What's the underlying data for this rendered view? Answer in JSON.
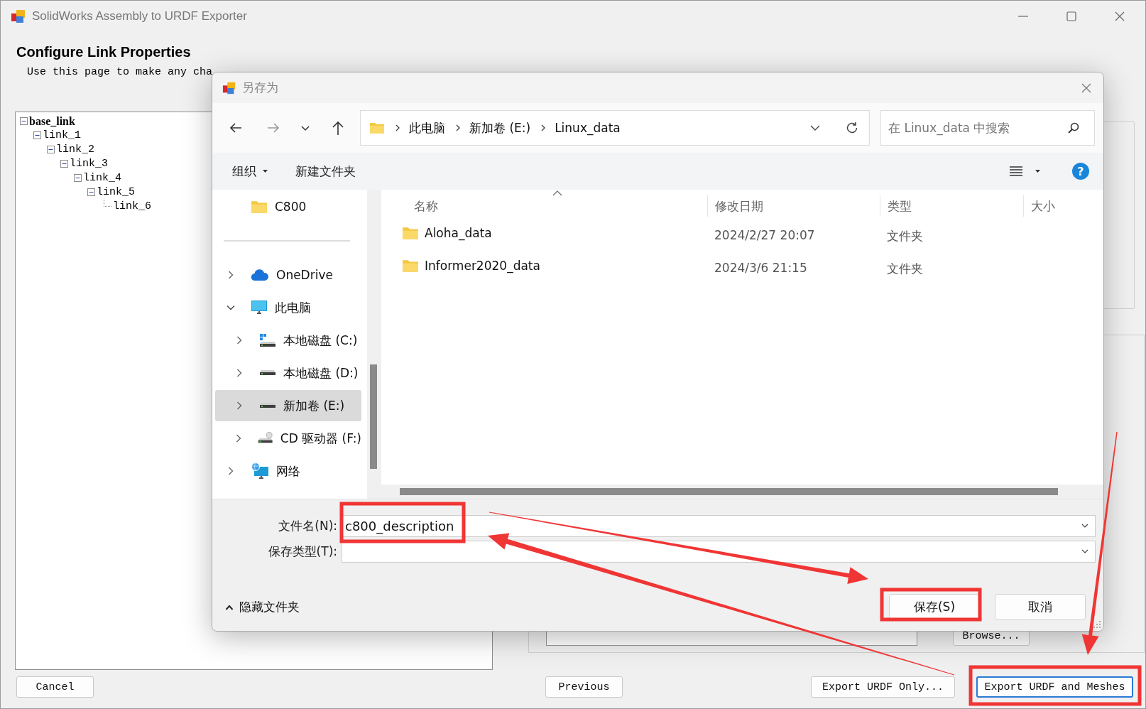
{
  "window": {
    "title": "SolidWorks Assembly to URDF Exporter"
  },
  "page": {
    "heading": "Configure Link Properties",
    "description": "Use this page to make any cha"
  },
  "link_tree": [
    {
      "label": "base_link",
      "expanded": true,
      "children": [
        {
          "label": "link_1",
          "expanded": true,
          "children": [
            {
              "label": "link_2",
              "expanded": true,
              "children": [
                {
                  "label": "link_3",
                  "expanded": true,
                  "children": [
                    {
                      "label": "link_4",
                      "expanded": true,
                      "children": [
                        {
                          "label": "link_5",
                          "expanded": true,
                          "children": [
                            {
                              "label": "link_6"
                            }
                          ]
                        }
                      ]
                    }
                  ]
                }
              ]
            }
          ]
        }
      ]
    }
  ],
  "right_panel": {
    "browse_button": "Browse..."
  },
  "buttons": [
    {
      "label": "Cancel",
      "focused": false
    },
    {
      "label": "Previous",
      "focused": false
    },
    {
      "label": "Export URDF Only...",
      "focused": false
    },
    {
      "label": "Export URDF and Meshes",
      "focused": true
    }
  ],
  "dialog": {
    "title": "另存为",
    "breadcrumb": [
      "此电脑",
      "新加卷 (E:)",
      "Linux_data"
    ],
    "search": {
      "placeholder": "在 Linux_data 中搜索"
    },
    "toolbar": {
      "organize": "组织",
      "new_folder": "新建文件夹",
      "help": "?"
    },
    "nav": [
      {
        "label": "C800",
        "kind": "folder",
        "selected": false
      },
      {
        "kind": "separator"
      },
      {
        "label": "OneDrive",
        "kind": "cloud",
        "expanded": false,
        "selected": false
      },
      {
        "label": "此电脑",
        "kind": "computer",
        "expanded": true,
        "selected": false,
        "children": [
          {
            "label": "本地磁盘 (C:)",
            "kind": "system-drive",
            "expanded": false,
            "selected": false
          },
          {
            "label": "本地磁盘 (D:)",
            "kind": "drive",
            "expanded": false,
            "selected": false
          },
          {
            "label": "新加卷 (E:)",
            "kind": "drive",
            "expanded": false,
            "selected": true
          },
          {
            "label": "CD 驱动器 (F:)",
            "kind": "cd-drive",
            "expanded": false,
            "selected": false
          }
        ]
      },
      {
        "label": "网络",
        "kind": "network",
        "expanded": false,
        "selected": false
      }
    ],
    "columns": [
      "名称",
      "修改日期",
      "类型",
      "大小"
    ],
    "files": [
      {
        "name": "Aloha_data",
        "date": "2024/2/27 20:07",
        "type": "文件夹"
      },
      {
        "name": "Informer2020_data",
        "date": "2024/3/6 21:15",
        "type": "文件夹"
      }
    ],
    "file_name": {
      "label": "文件名(N):",
      "value": "c800_description"
    },
    "file_type": {
      "label": "保存类型(T):"
    },
    "hide_folders": "隐藏文件夹",
    "buttons": {
      "save": "保存(S)",
      "cancel": "取消"
    }
  }
}
